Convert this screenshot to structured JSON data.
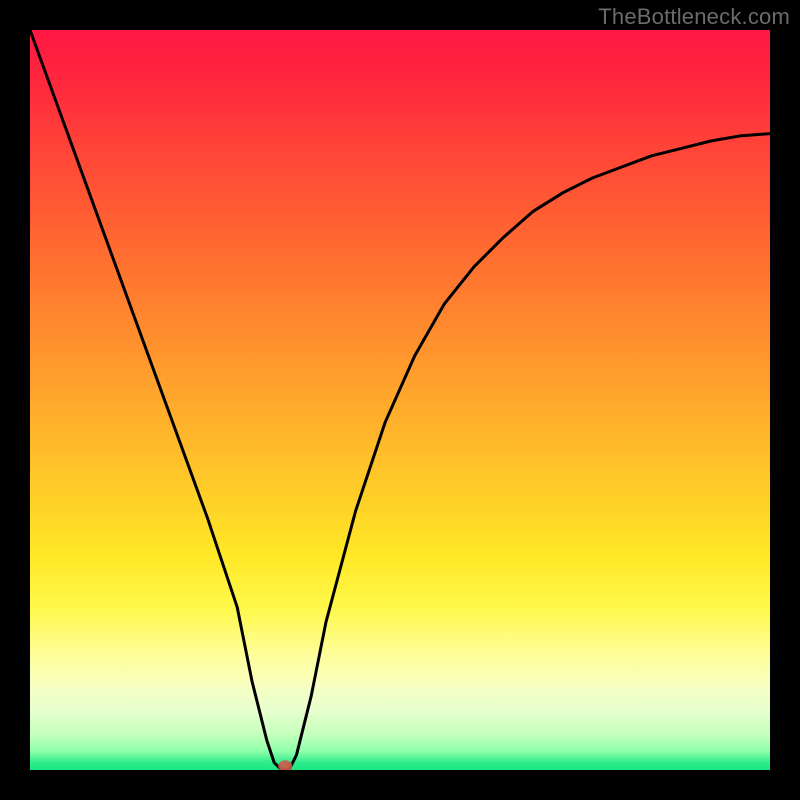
{
  "watermark": "TheBottleneck.com",
  "chart_data": {
    "type": "line",
    "title": "",
    "xlabel": "",
    "ylabel": "",
    "xlim": [
      0,
      100
    ],
    "ylim": [
      0,
      100
    ],
    "gradient_stops": [
      {
        "pos": 0,
        "color": "#ff1744"
      },
      {
        "pos": 50,
        "color": "#ffba2a"
      },
      {
        "pos": 78,
        "color": "#fff84a"
      },
      {
        "pos": 100,
        "color": "#19e783"
      }
    ],
    "series": [
      {
        "name": "bottleneck-curve",
        "color": "#000000",
        "x": [
          0,
          4,
          8,
          12,
          16,
          20,
          24,
          28,
          30,
          32,
          33,
          34,
          35,
          36,
          38,
          40,
          44,
          48,
          52,
          56,
          60,
          64,
          68,
          72,
          76,
          80,
          84,
          88,
          92,
          96,
          100
        ],
        "y": [
          100,
          89,
          78,
          67,
          56,
          45,
          34,
          22,
          12,
          4,
          1,
          0,
          0,
          2,
          10,
          20,
          35,
          47,
          56,
          63,
          68,
          72,
          75.5,
          78,
          80,
          81.5,
          83,
          84,
          85,
          85.7,
          86
        ]
      }
    ],
    "marker": {
      "name": "optimal-point",
      "x": 34.5,
      "y": 0.5,
      "color": "#cc5a4a",
      "rx": 7,
      "ry": 6
    }
  }
}
